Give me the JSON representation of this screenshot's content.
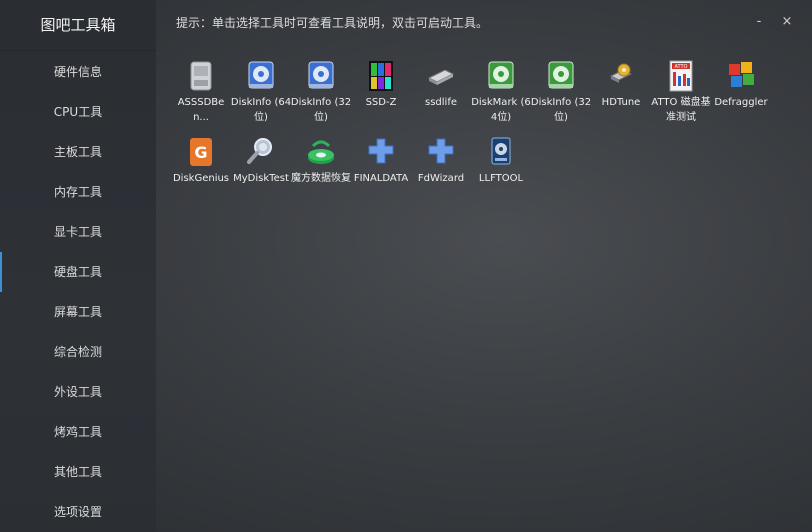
{
  "app": {
    "title": "图吧工具箱"
  },
  "hint": "提示：单击选择工具时可查看工具说明，双击可启动工具。",
  "window": {
    "minimize": "-",
    "close": "×"
  },
  "sidebar": {
    "items": [
      {
        "label": "硬件信息"
      },
      {
        "label": "CPU工具"
      },
      {
        "label": "主板工具"
      },
      {
        "label": "内存工具"
      },
      {
        "label": "显卡工具"
      },
      {
        "label": "硬盘工具",
        "active": true
      },
      {
        "label": "屏幕工具"
      },
      {
        "label": "综合检测"
      },
      {
        "label": "外设工具"
      },
      {
        "label": "烤鸡工具"
      },
      {
        "label": "其他工具"
      },
      {
        "label": "选项设置"
      }
    ]
  },
  "tools": [
    {
      "label": "ASSSDBen...",
      "icon": "drive-icon"
    },
    {
      "label": "DiskInfo (64位)",
      "icon": "diskinfo-icon"
    },
    {
      "label": "DiskInfo (32位)",
      "icon": "diskinfo-icon"
    },
    {
      "label": "SSD-Z",
      "icon": "ssdz-icon"
    },
    {
      "label": "ssdlife",
      "icon": "chip-icon"
    },
    {
      "label": "DiskMark (64位)",
      "icon": "diskmark-icon"
    },
    {
      "label": "DiskInfo (32位)",
      "icon": "diskmark-icon"
    },
    {
      "label": "HDTune",
      "icon": "hdtune-icon"
    },
    {
      "label": "ATTO 磁盘基准测试",
      "icon": "atto-icon"
    },
    {
      "label": "Defraggler",
      "icon": "defraggler-icon"
    },
    {
      "label": "DiskGenius",
      "icon": "diskgenius-icon"
    },
    {
      "label": "MyDiskTest",
      "icon": "mydisktest-icon"
    },
    {
      "label": "魔方数据恢复",
      "icon": "recovery-icon"
    },
    {
      "label": "FINALDATA",
      "icon": "puzzle-icon"
    },
    {
      "label": "FdWizard",
      "icon": "puzzle-icon"
    },
    {
      "label": "LLFTOOL",
      "icon": "llftool-icon"
    }
  ],
  "colors": {
    "accent": "#3f8fd6",
    "sidebar_bg": "#2c3035",
    "content_bg": "#3a3d41"
  }
}
